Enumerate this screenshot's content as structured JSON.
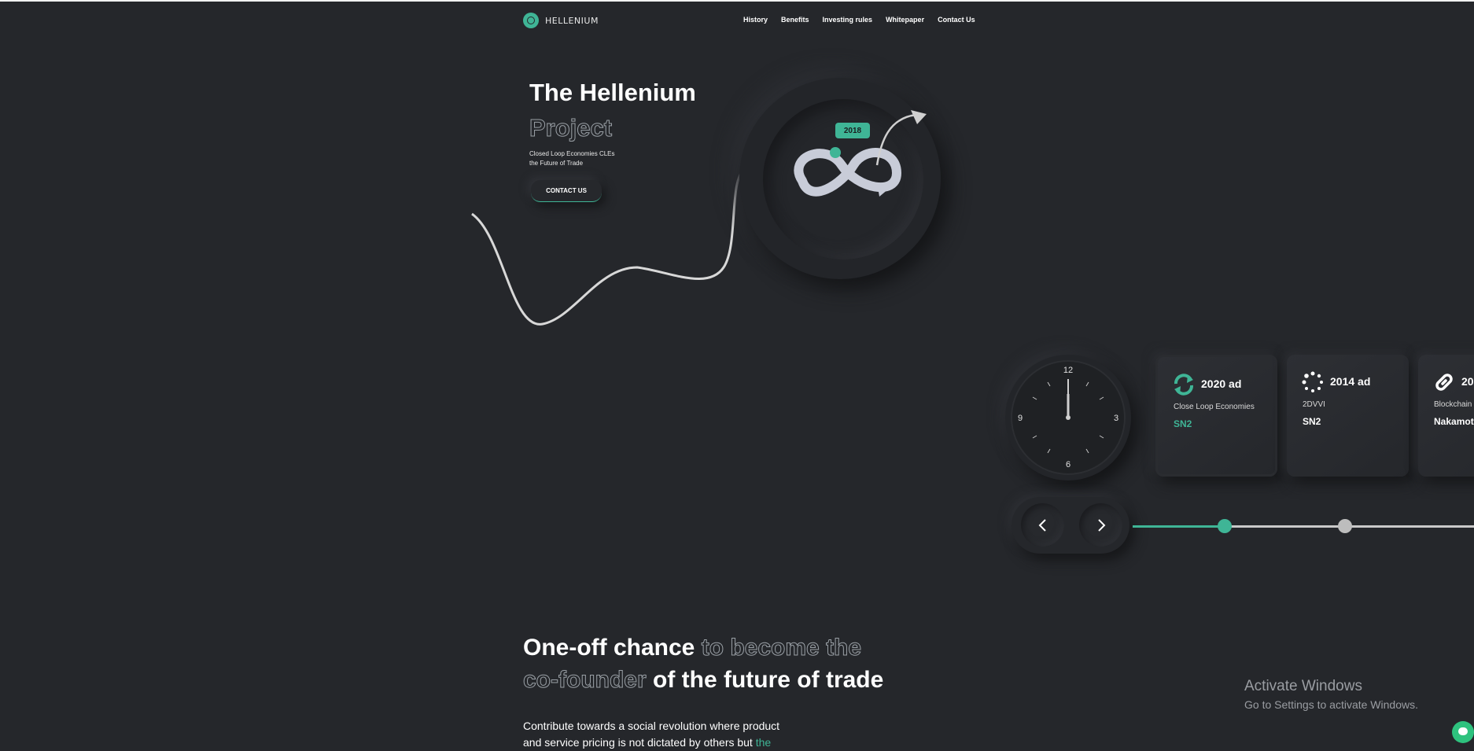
{
  "header": {
    "logo_text": "HELLENIUM",
    "nav": [
      "History",
      "Benefits",
      "Investing rules",
      "Whitepaper",
      "Contact Us"
    ]
  },
  "hero": {
    "title_line1": "The Hellenium",
    "title_line2": "Project",
    "subtitle_line1": "Closed Loop Economies CLEs",
    "subtitle_line2": "the Future of Trade",
    "cta": "CONTACT US",
    "badge_year": "2018"
  },
  "clock": {
    "labels": [
      "12",
      "3",
      "6",
      "9"
    ]
  },
  "timeline": {
    "cards": [
      {
        "year": "2020 ad",
        "label": "Close Loop Economies",
        "code": "SN2",
        "icon": "refresh-icon",
        "active": true
      },
      {
        "year": "2014 ad",
        "label": "2DVVI",
        "code": "SN2",
        "icon": "dots-loader-icon",
        "active": false
      },
      {
        "year": "20",
        "label": "Blockchain",
        "code": "Nakamot",
        "icon": "chain-link-icon",
        "active": false
      }
    ],
    "prev_icon": "chevron-left-icon",
    "next_icon": "chevron-right-icon"
  },
  "section": {
    "title_a": "One-off chance ",
    "title_b": "to become the",
    "title_c": "co-founder",
    "title_d": " of the future of trade",
    "body_line1": "Contribute towards a social revolution where product",
    "body_line2": "and service pricing is not dictated by others but ",
    "body_accent": "the"
  },
  "watermark": {
    "title": "Activate Windows",
    "subtitle": "Go to Settings to activate Windows."
  },
  "colors": {
    "background": "#25272b",
    "accent": "#3fb596",
    "text": "#ffffff"
  }
}
